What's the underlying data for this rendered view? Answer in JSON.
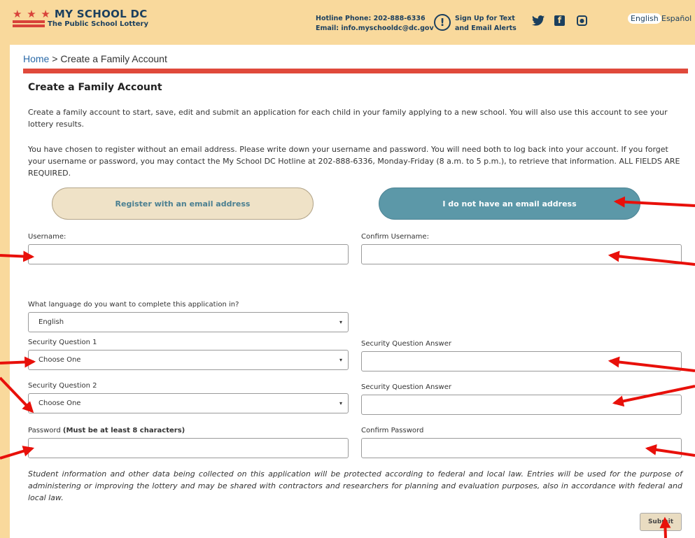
{
  "header": {
    "logo_stars": "★ ★ ★",
    "logo_title": "MY SCHOOL DC",
    "logo_subtitle": "The Public School Lottery",
    "hotline": "Hotline Phone: 202-888-6336",
    "email": "Email: info.myschooldc@dc.gov",
    "alert_line1": "Sign Up for Text",
    "alert_line2": "and Email Alerts",
    "lang_english": "English",
    "lang_spanish": "Español",
    "icons": [
      "alert-icon",
      "twitter-icon",
      "facebook-icon",
      "instagram-icon"
    ]
  },
  "breadcrumb": {
    "home": "Home",
    "separator": " > ",
    "current": "Create a Family Account"
  },
  "page": {
    "title": "Create a Family Account",
    "intro": "Create a family account to start, save, edit and submit an application for each child in your family applying to a new school. You will also use this account to see your lottery results.",
    "notice": "You have chosen to register without an email address. Please write down your username and password. You will need both to log back into your account. If you forget your username or password, you may contact the My School DC Hotline at 202-888-6336, Monday-Friday (8 a.m. to 5 p.m.), to retrieve that information. ALL FIELDS ARE REQUIRED."
  },
  "tabs": {
    "with_email": "Register with an email address",
    "without_email": "I do not have an email address"
  },
  "form": {
    "username_label": "Username:",
    "username_value": "",
    "confirm_username_label": "Confirm Username:",
    "confirm_username_value": "",
    "language_label": "What language do you want to complete this application in?",
    "language_value": "English",
    "security_q1_label": "Security Question 1",
    "security_q1_value": "Choose One",
    "security_a1_label": "Security Question Answer",
    "security_a1_value": "",
    "security_q2_label": "Security Question 2",
    "security_q2_value": "Choose One",
    "security_a2_label": "Security Question Answer",
    "security_a2_value": "",
    "password_label": "Password",
    "password_hint": "(Must be at least 8 characters)",
    "password_value": "",
    "confirm_password_label": "Confirm Password",
    "confirm_password_value": "",
    "caret": "▾"
  },
  "disclaimer": "Student information and other data being collected on this application will be protected according to federal and local law. Entries will be used for the purpose of administering or improving the lottery and may be shared with contractors and researchers for planning and evaluation purposes, also in accordance with federal and local law.",
  "submit_label": "Submit",
  "colors": {
    "header_bg": "#f9d99c",
    "brand_navy": "#1b3f5e",
    "accent_red": "#e0493b",
    "teal_button": "#5c98a8",
    "beige_button": "#efe2c7",
    "annotation_arrow": "#e8100a"
  }
}
